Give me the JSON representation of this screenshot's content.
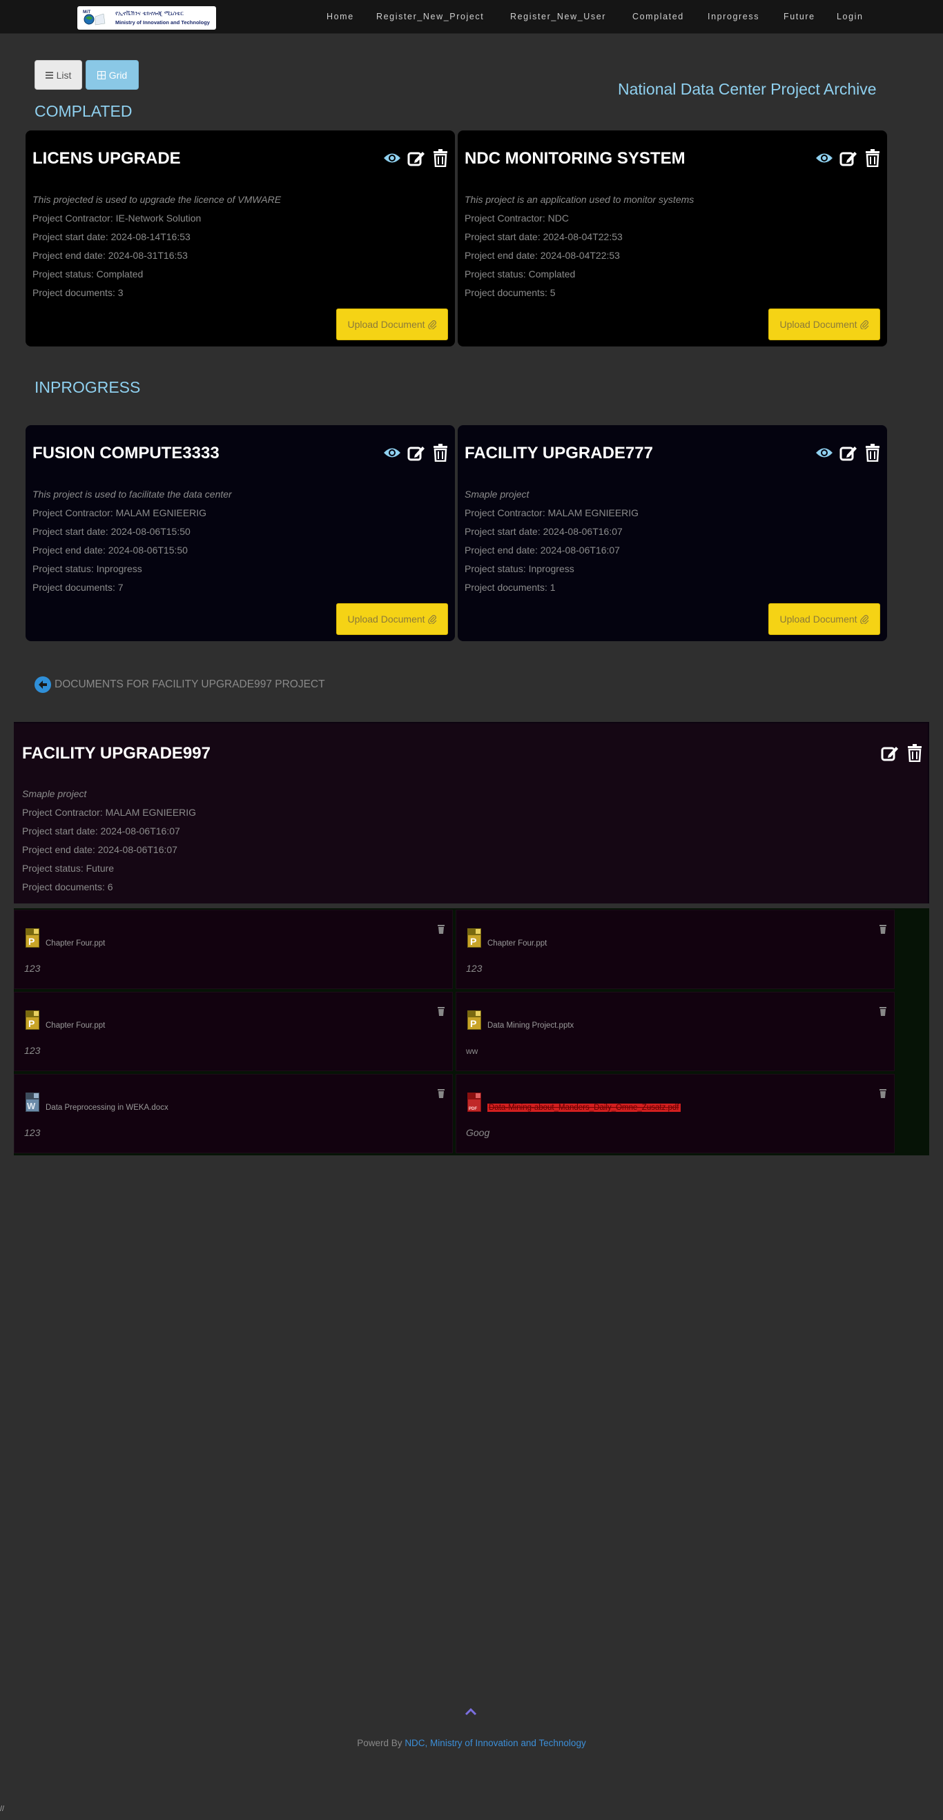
{
  "navbar": {
    "logo": {
      "emblem_text": "MiT",
      "title_amharic": "የኢኖቬሽንና ቴክኖሎጂ ሚኒስቴር",
      "subtitle": "Ministry of Innovation and Technology"
    },
    "links": [
      "Home",
      "Register_New_Project",
      "Register_New_User",
      "Complated",
      "Inprogress",
      "Future",
      "Login"
    ]
  },
  "view_toggle": {
    "list_label": "List",
    "grid_label": "Grid",
    "active": "Grid"
  },
  "archive_title": "National Data Center Project Archive",
  "sections": {
    "completed": {
      "title": "COMPLATED",
      "projects": [
        {
          "title": "LICENS UPGRADE",
          "description": "This projected is used to upgrade the licence of VMWARE",
          "contractor": "Project Contractor: IE-Network Solution",
          "start": "Project start date: 2024-08-14T16:53",
          "end": "Project end date: 2024-08-31T16:53",
          "status": "Project status: Complated",
          "documents": "Project documents: 3",
          "upload_label": "Upload Document"
        },
        {
          "title": "NDC MONITORING SYSTEM",
          "description": "This project is an application used to monitor systems",
          "contractor": "Project Contractor: NDC",
          "start": "Project start date: 2024-08-04T22:53",
          "end": "Project end date: 2024-08-04T22:53",
          "status": "Project status: Complated",
          "documents": "Project documents: 5",
          "upload_label": "Upload Document"
        }
      ]
    },
    "inprogress": {
      "title": "INPROGRESS",
      "projects": [
        {
          "title": "FUSION COMPUTE3333",
          "description": "This project is used to facilitate the data center",
          "contractor": "Project Contractor: MALAM EGNIEERIG",
          "start": "Project start date: 2024-08-06T15:50",
          "end": "Project end date: 2024-08-06T15:50",
          "status": "Project status: Inprogress",
          "documents": "Project documents: 7",
          "upload_label": "Upload Document"
        },
        {
          "title": "FACILITY UPGRADE777",
          "description": "Smaple project",
          "contractor": "Project Contractor: MALAM EGNIEERIG",
          "start": "Project start date: 2024-08-06T16:07",
          "end": "Project end date: 2024-08-06T16:07",
          "status": "Project status: Inprogress",
          "documents": "Project documents: 1",
          "upload_label": "Upload Document"
        }
      ]
    }
  },
  "documents_section": {
    "heading": "DOCUMENTS FOR FACILITY UPGRADE997 PROJECT",
    "project": {
      "title": "FACILITY UPGRADE997",
      "description": "Smaple project",
      "contractor": "Project Contractor: MALAM EGNIEERIG",
      "start": "Project start date: 2024-08-06T16:07",
      "end": "Project end date: 2024-08-06T16:07",
      "status": "Project status: Future",
      "documents": "Project documents: 6"
    },
    "documents": [
      {
        "name": "Chapter Four.ppt",
        "type": "ppt",
        "description": "123"
      },
      {
        "name": "Chapter Four.ppt",
        "type": "ppt",
        "description": "123"
      },
      {
        "name": "Chapter Four.ppt",
        "type": "ppt",
        "description": "123"
      },
      {
        "name": "Data Mining Project.pptx",
        "type": "ppt",
        "description": "ww"
      },
      {
        "name": "Data Preprocessing in WEKA.docx",
        "type": "doc",
        "description": "123"
      },
      {
        "name": "Data-Mining-about_Manders_Daily_Omne_Zusatz.pdf",
        "type": "pdf",
        "description": "Goog"
      }
    ]
  },
  "footer": {
    "prefix": "Powerd By ",
    "link_text": "NDC, Ministry of Innovation and Technology",
    "corner": "//"
  },
  "colors": {
    "page_bg": "#2f2f2f",
    "accent": "#8fd0ef",
    "upload_button": "#f5d315",
    "footer_link": "#3c8fd8"
  }
}
